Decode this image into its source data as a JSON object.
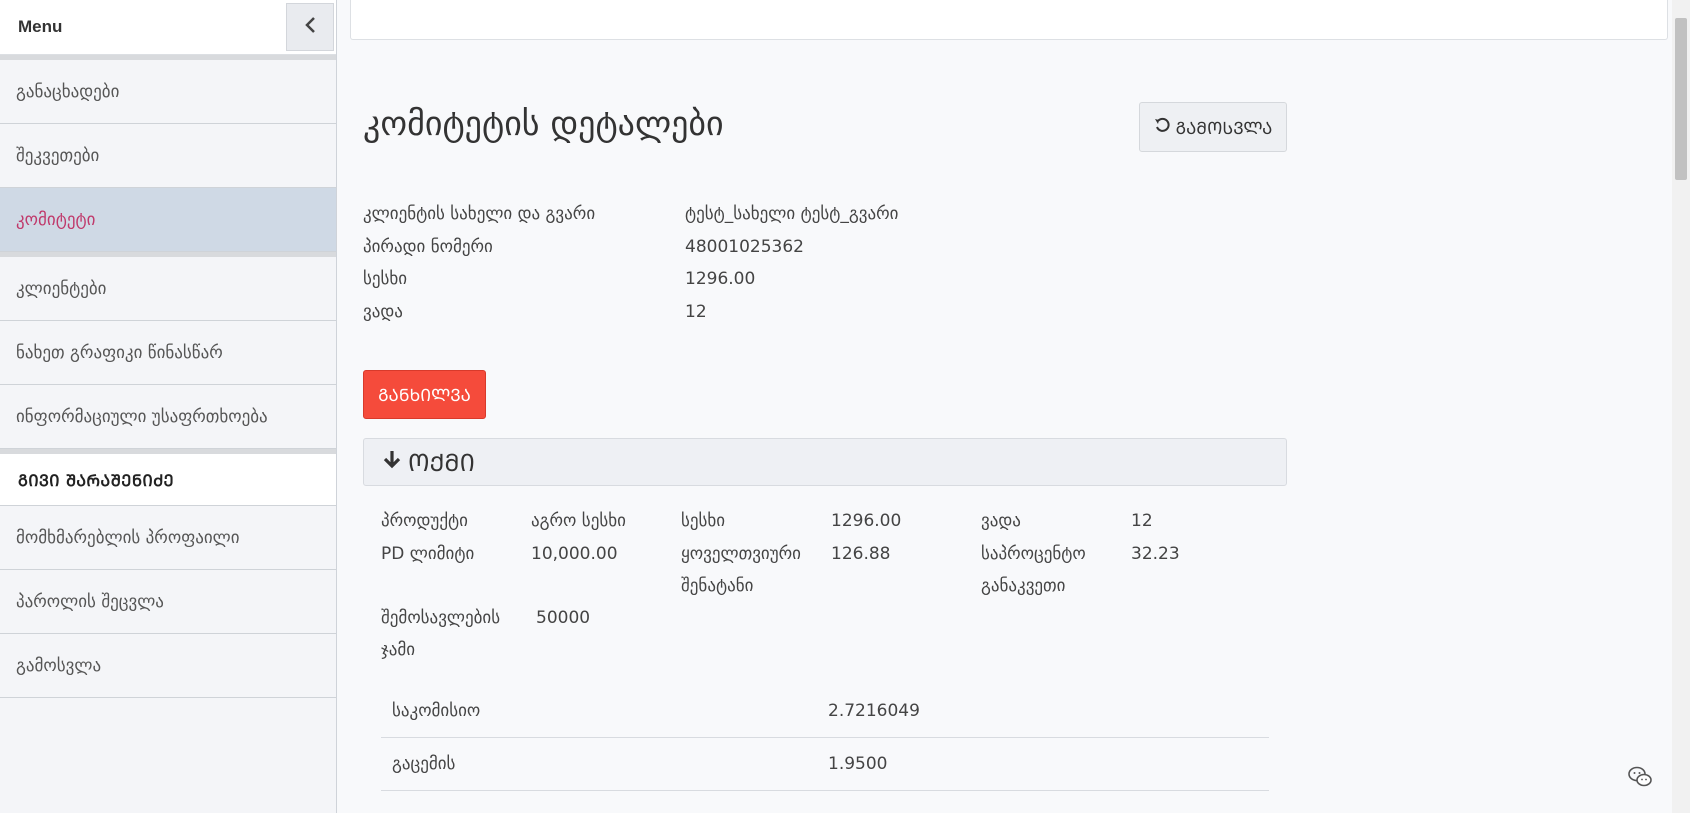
{
  "sidebar": {
    "title": "Menu",
    "items": [
      {
        "label": "განაცხადები"
      },
      {
        "label": "შეკვეთები"
      },
      {
        "label": "კომიტეტი",
        "active": true
      },
      {
        "label": "კლიენტები"
      },
      {
        "label": "ნახეთ გრაფიკი წინასწარ"
      },
      {
        "label": "ინფორმაციული უსაფრთხოება"
      }
    ],
    "group_title": "ᲒᲘᲕᲘ ᲨᲐᲠᲐᲨᲔᲜᲘᲫᲔ",
    "group_items": [
      {
        "label": "მომხმარებლის პროფაილი"
      },
      {
        "label": "პაროლის შეცვლა"
      },
      {
        "label": "გამოსვლა"
      }
    ]
  },
  "main": {
    "title": "კომიტეტის დეტალები",
    "back_label": "ᲒᲐᲛᲝᲡᲕᲚᲐ",
    "info": [
      {
        "label": "კლიენტის სახელი და გვარი",
        "value": "ტესტ_სახელი ტესტ_გვარი"
      },
      {
        "label": "პირადი ნომერი",
        "value": "48001025362"
      },
      {
        "label": "სესხი",
        "value": "1296.00"
      },
      {
        "label": "ვადა",
        "value": "12"
      }
    ],
    "decline_label": "ᲒᲐᲜᲮᲘᲚᲕᲐ",
    "panel_title": "ᲝᲥᲛᲘ",
    "grid": {
      "r1": {
        "l1": "პროდუქტი",
        "v1": "აგრო სესხი",
        "l2": "სესხი",
        "v2": "1296.00",
        "l3": "ვადა",
        "v3": "12"
      },
      "r2": {
        "l1": "PD ლიმიტი",
        "v1": "10,000.00",
        "l2": "ყოველთვიური შენატანი",
        "v2": "126.88",
        "l3": "საპროცენტო განაკვეთი",
        "v3": "32.23"
      },
      "r3": {
        "l1": "შემოსავლების ჯამი",
        "v1": "50000"
      }
    },
    "fin_rows": [
      {
        "label": "საკომისიო",
        "value": "2.7216049"
      },
      {
        "label": "გაცემის",
        "value": "1.9500"
      }
    ]
  },
  "colors": {
    "accent": "#f54b3b",
    "active_item_text": "#c0396b",
    "active_item_bg": "#cfd9e5"
  }
}
